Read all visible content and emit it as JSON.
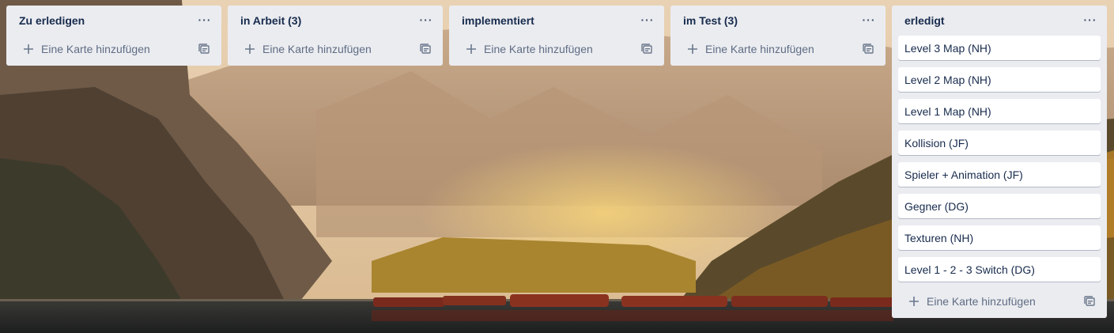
{
  "board": {
    "lists": [
      {
        "title": "Zu erledigen",
        "add_card_label": "Eine Karte hinzufügen",
        "cards": []
      },
      {
        "title": "in Arbeit (3)",
        "add_card_label": "Eine Karte hinzufügen",
        "cards": []
      },
      {
        "title": "implementiert",
        "add_card_label": "Eine Karte hinzufügen",
        "cards": []
      },
      {
        "title": "im Test (3)",
        "add_card_label": "Eine Karte hinzufügen",
        "cards": []
      },
      {
        "title": "erledigt",
        "add_card_label": "Eine Karte hinzufügen",
        "cards": [
          "Level 3 Map (NH)",
          "Level 2 Map (NH)",
          "Level 1 Map (NH)",
          "Kollision (JF)",
          "Spieler + Animation (JF)",
          "Gegner (DG)",
          "Texturen (NH)",
          "Level 1 - 2 - 3 Switch (DG)"
        ]
      }
    ],
    "menu_icon": "more-horizontal-icon",
    "add_icon": "plus-icon",
    "template_icon": "card-template-icon"
  },
  "colors": {
    "list_bg": "#ebecf0",
    "card_bg": "#ffffff",
    "title_text": "#172b4d",
    "muted_text": "#5e6c84"
  }
}
